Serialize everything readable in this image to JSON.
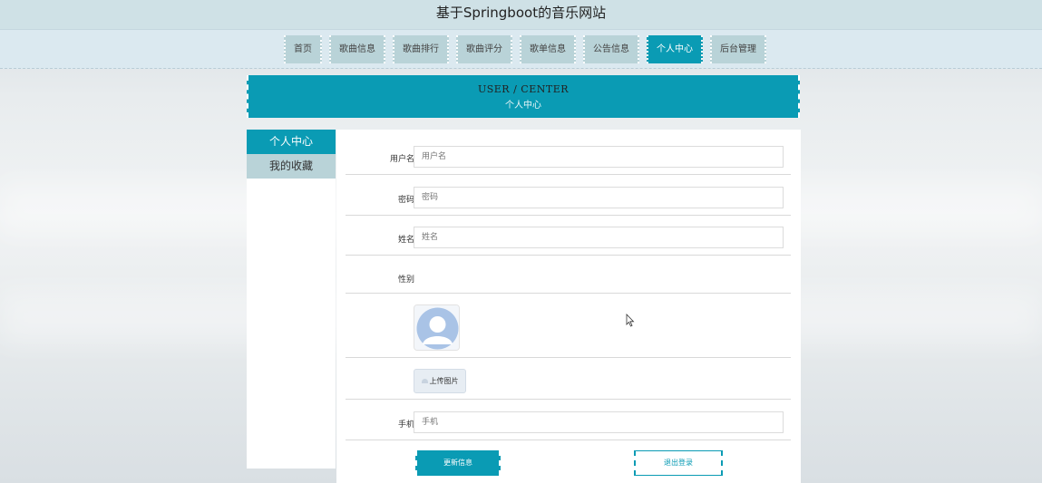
{
  "site": {
    "title": "基于Springboot的音乐网站"
  },
  "nav": {
    "items": [
      {
        "label": "首页"
      },
      {
        "label": "歌曲信息"
      },
      {
        "label": "歌曲排行"
      },
      {
        "label": "歌曲评分"
      },
      {
        "label": "歌单信息"
      },
      {
        "label": "公告信息"
      },
      {
        "label": "个人中心",
        "active": true
      },
      {
        "label": "后台管理"
      }
    ]
  },
  "banner": {
    "en": "USER / CENTER",
    "cn": "个人中心"
  },
  "sidebar": {
    "items": [
      {
        "label": "个人中心",
        "active": true
      },
      {
        "label": "我的收藏"
      }
    ]
  },
  "form": {
    "username": {
      "label": "用户名",
      "placeholder": "用户名",
      "value": ""
    },
    "password": {
      "label": "密码",
      "placeholder": "密码",
      "value": ""
    },
    "name": {
      "label": "姓名",
      "placeholder": "姓名",
      "value": ""
    },
    "gender": {
      "label": "性别"
    },
    "upload_label": "上传图片",
    "phone": {
      "label": "手机",
      "placeholder": "手机",
      "value": ""
    },
    "update_label": "更新信息",
    "logout_label": "退出登录"
  },
  "colors": {
    "accent": "#0a9bb4",
    "nav_bg": "#dbe9f0",
    "nav_item": "#b9d3d8",
    "title_bar": "#cfe1e6"
  },
  "icons": {
    "avatar": "user-avatar-placeholder-icon",
    "upload": "cloud-upload-icon",
    "cursor": "mouse-pointer-icon"
  }
}
